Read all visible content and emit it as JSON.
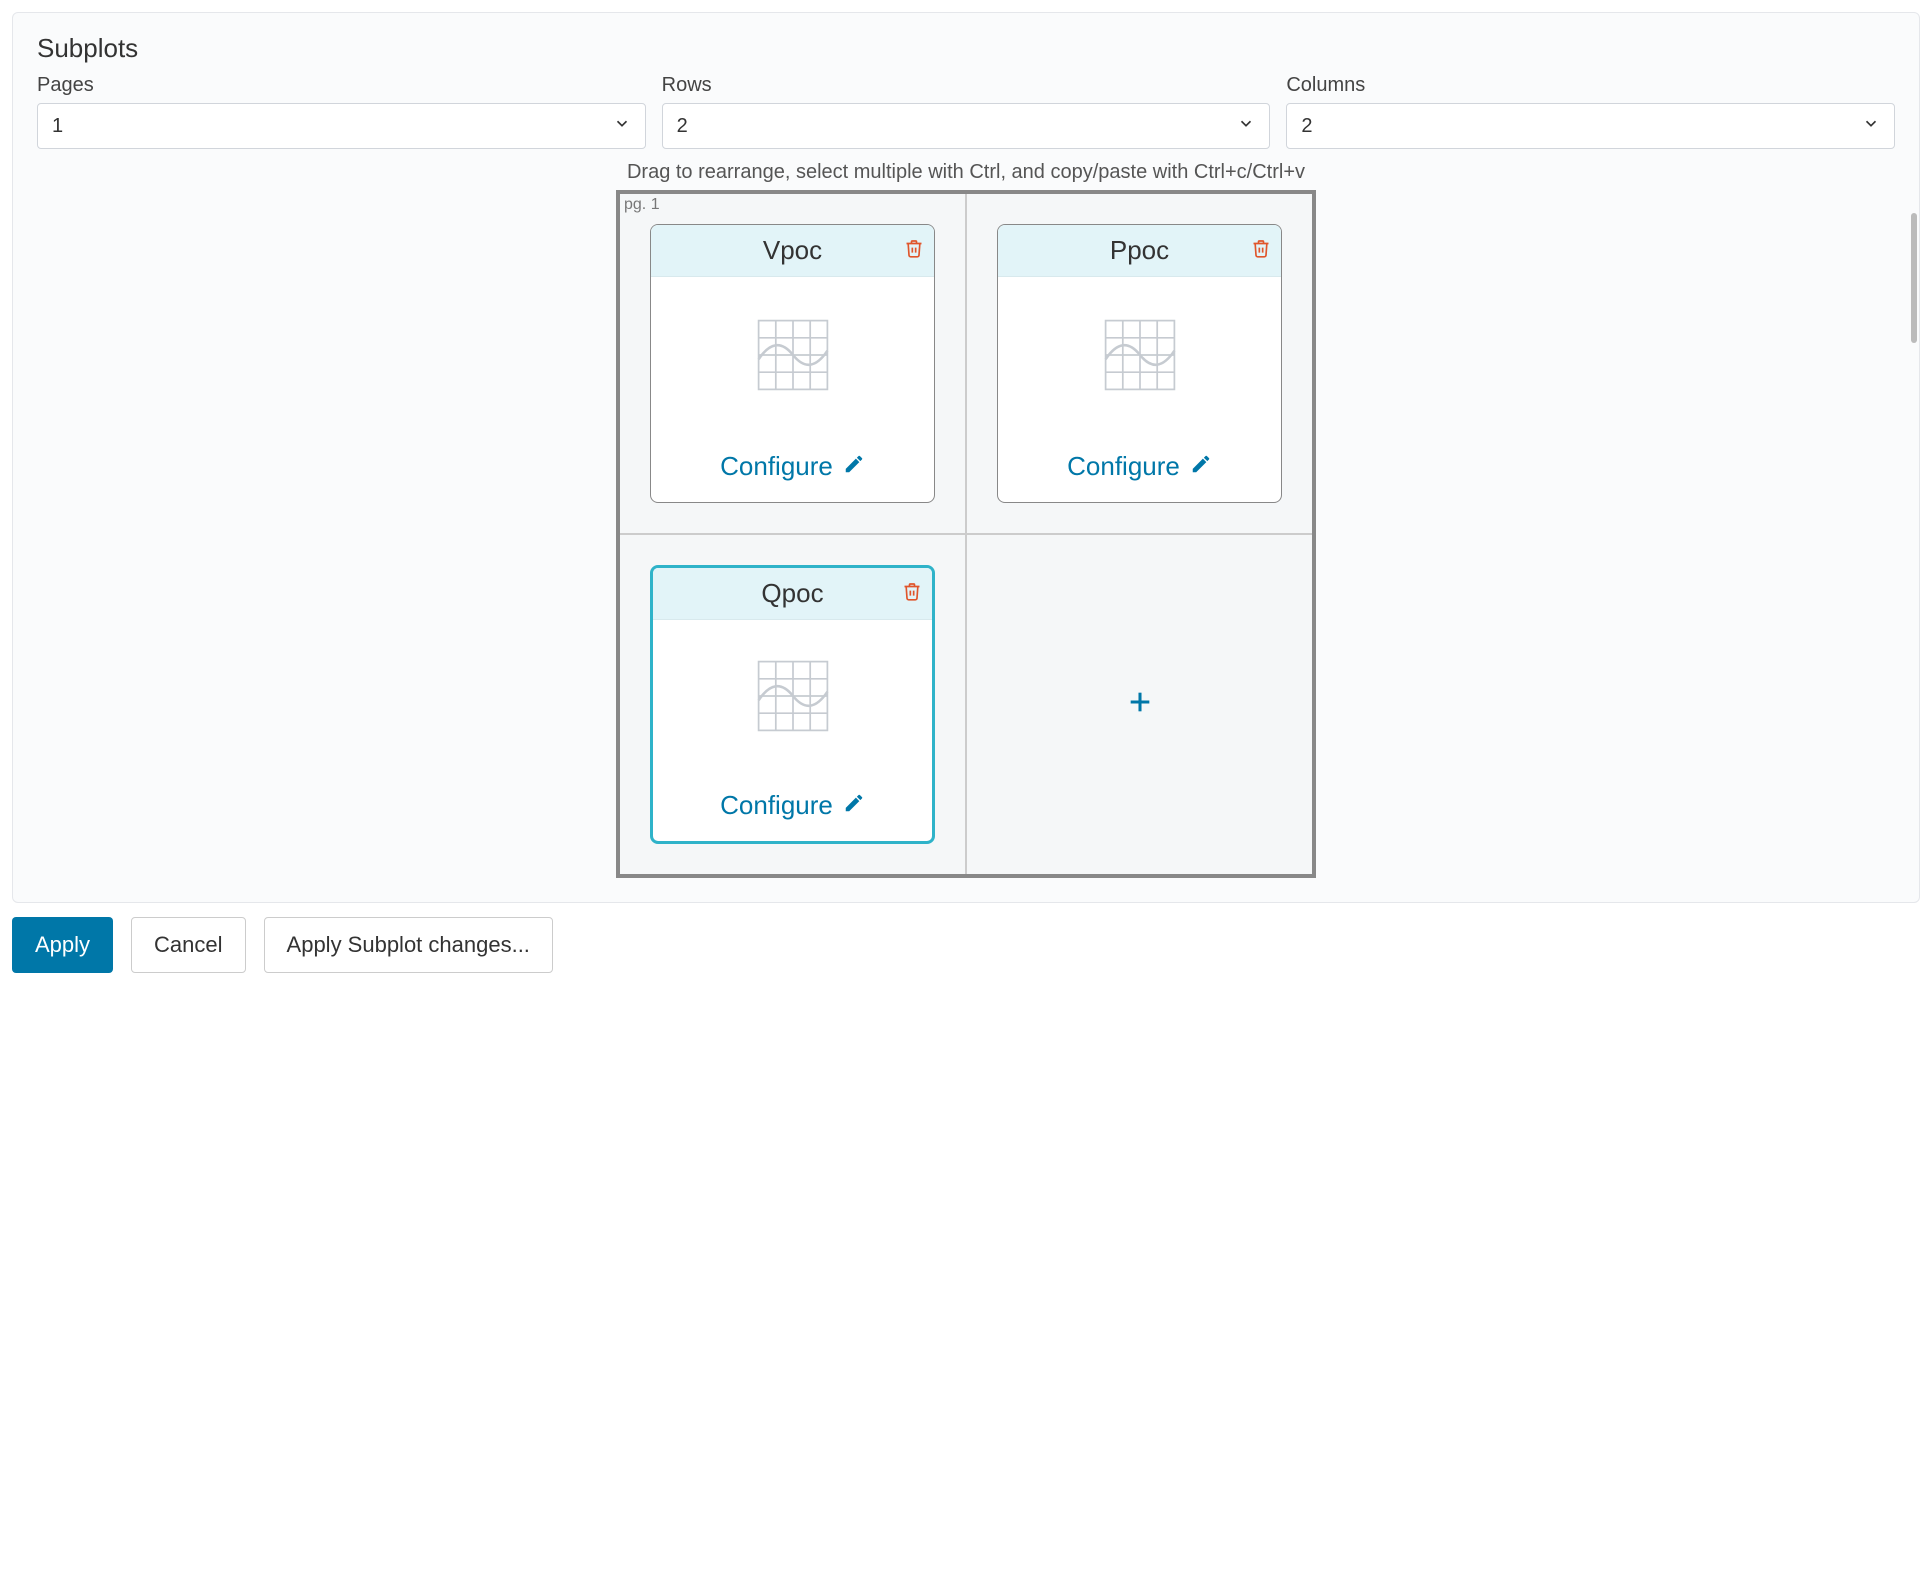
{
  "panel": {
    "title": "Subplots",
    "helper": "Drag to rearrange, select multiple with Ctrl, and copy/paste with Ctrl+c/Ctrl+v"
  },
  "controls": {
    "pages": {
      "label": "Pages",
      "value": "1"
    },
    "rows": {
      "label": "Rows",
      "value": "2"
    },
    "columns": {
      "label": "Columns",
      "value": "2"
    }
  },
  "grid": {
    "page_label": "pg. 1",
    "cards": [
      {
        "title": "Vpoc",
        "configure": "Configure",
        "selected": false
      },
      {
        "title": "Ppoc",
        "configure": "Configure",
        "selected": false
      },
      {
        "title": "Qpoc",
        "configure": "Configure",
        "selected": true
      }
    ]
  },
  "actions": {
    "apply": "Apply",
    "cancel": "Cancel",
    "apply_subplot": "Apply Subplot changes..."
  }
}
